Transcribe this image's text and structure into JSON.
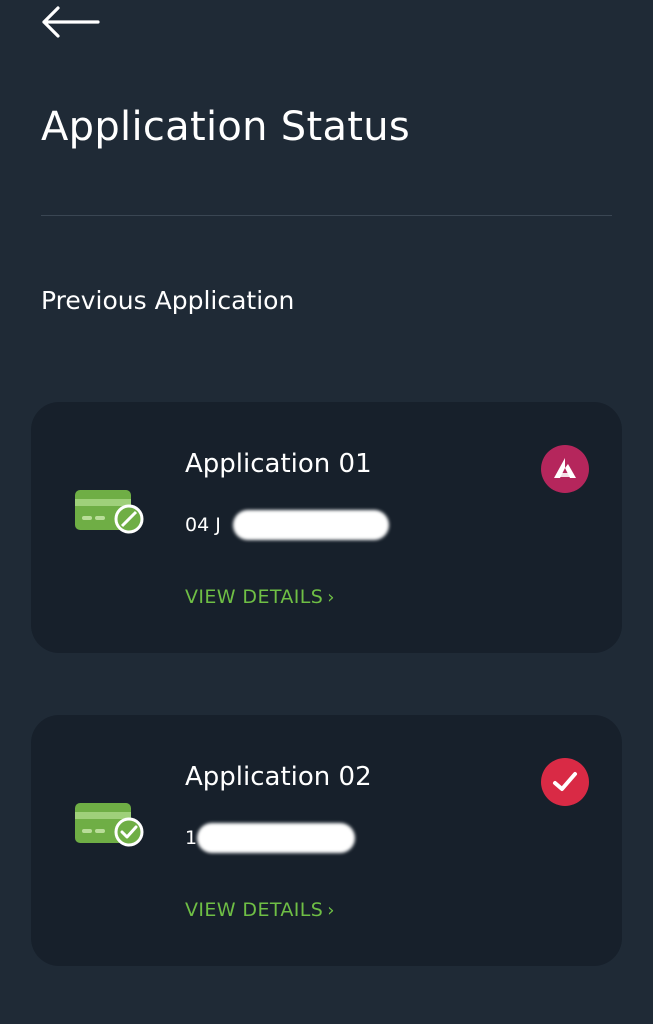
{
  "header": {
    "title": "Application Status"
  },
  "section": {
    "title": "Previous Application"
  },
  "applications": [
    {
      "title": "Application 01",
      "date": "04 J",
      "action_label": "VIEW DETAILS",
      "status_icon": "bank-logo-icon",
      "card_icon": "card-blocked-icon"
    },
    {
      "title": "Application 02",
      "date": "1",
      "action_label": "VIEW DETAILS",
      "status_icon": "check-icon",
      "card_icon": "card-approved-icon"
    }
  ],
  "colors": {
    "background": "#1f2a36",
    "card": "#17202b",
    "accent_green": "#6fbf45",
    "badge_bank": "#b5265c",
    "badge_check": "#d92a45"
  }
}
